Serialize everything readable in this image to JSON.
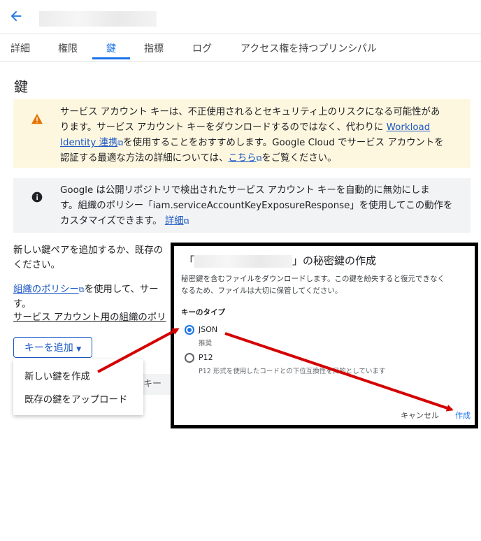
{
  "header": {
    "back_icon": "arrow-back-icon",
    "title_blurred": ""
  },
  "tabs": [
    "詳細",
    "権限",
    "鍵",
    "指標",
    "ログ",
    "アクセス権を持つプリンシパル"
  ],
  "active_tab": "鍵",
  "page_title": "鍵",
  "warning": {
    "icon": "warning-icon",
    "line1": "サービス アカウント キーは、不正使用されるとセキュリティ上のリスクになる可能性があ",
    "line2a": "ります。サービス アカウント キーをダウンロードするのではなく、代わりに ",
    "link1a": "Workload",
    "link1b": "Identity 連携",
    "line3b": "を使用することをおすすめします。Google Cloud でサービス アカウントを",
    "line4a": "認証する最適な方法の詳細については、",
    "link2": "こちら",
    "line4b": "をご覧ください。"
  },
  "notice": {
    "icon": "info-icon",
    "line1": "Google は公開リポジトリで検出されたサービス アカウント キーを自動的に無効にしま",
    "line2": "す。組織のポリシー「iam.serviceAccountKeyExposureResponse」を使用してこの動作を",
    "line3a": "カスタマイズできます。",
    "link": "詳細"
  },
  "body": {
    "p1_line1": "新しい鍵ペアを追加するか、既存の",
    "p1_line2": "ください。",
    "p2_link": "組織のポリシー",
    "p2_text": "を使用して、サー",
    "p2_line2": "す。",
    "p2_link2": "サービス アカウント用の組織のポリ"
  },
  "add_key": {
    "label": "キーを追加",
    "icon": "caret-down-icon"
  },
  "menu": {
    "items": [
      "新しい鍵を作成",
      "既存の鍵をアップロード"
    ]
  },
  "table_header_fragment": "キー",
  "dialog": {
    "title_open": "「",
    "title_close": "」の秘密鍵の作成",
    "desc_line1": "秘密鍵を含むファイルをダウンロードします。この鍵を紛失すると復元できなく",
    "desc_line2": "なるため、ファイルは大切に保管してください。",
    "key_type_label": "キーのタイプ",
    "options": [
      {
        "label": "JSON",
        "sub": "推奨",
        "selected": true
      },
      {
        "label": "P12",
        "sub": "P12 形式を使用したコードとの下位互換性を目的としています",
        "selected": false
      }
    ],
    "cancel": "キャンセル",
    "create": "作成"
  },
  "colors": {
    "accent": "#1a73e8",
    "warning_bg": "#fef7e0",
    "info_bg": "#f1f3f4",
    "arrow": "#d40000"
  }
}
